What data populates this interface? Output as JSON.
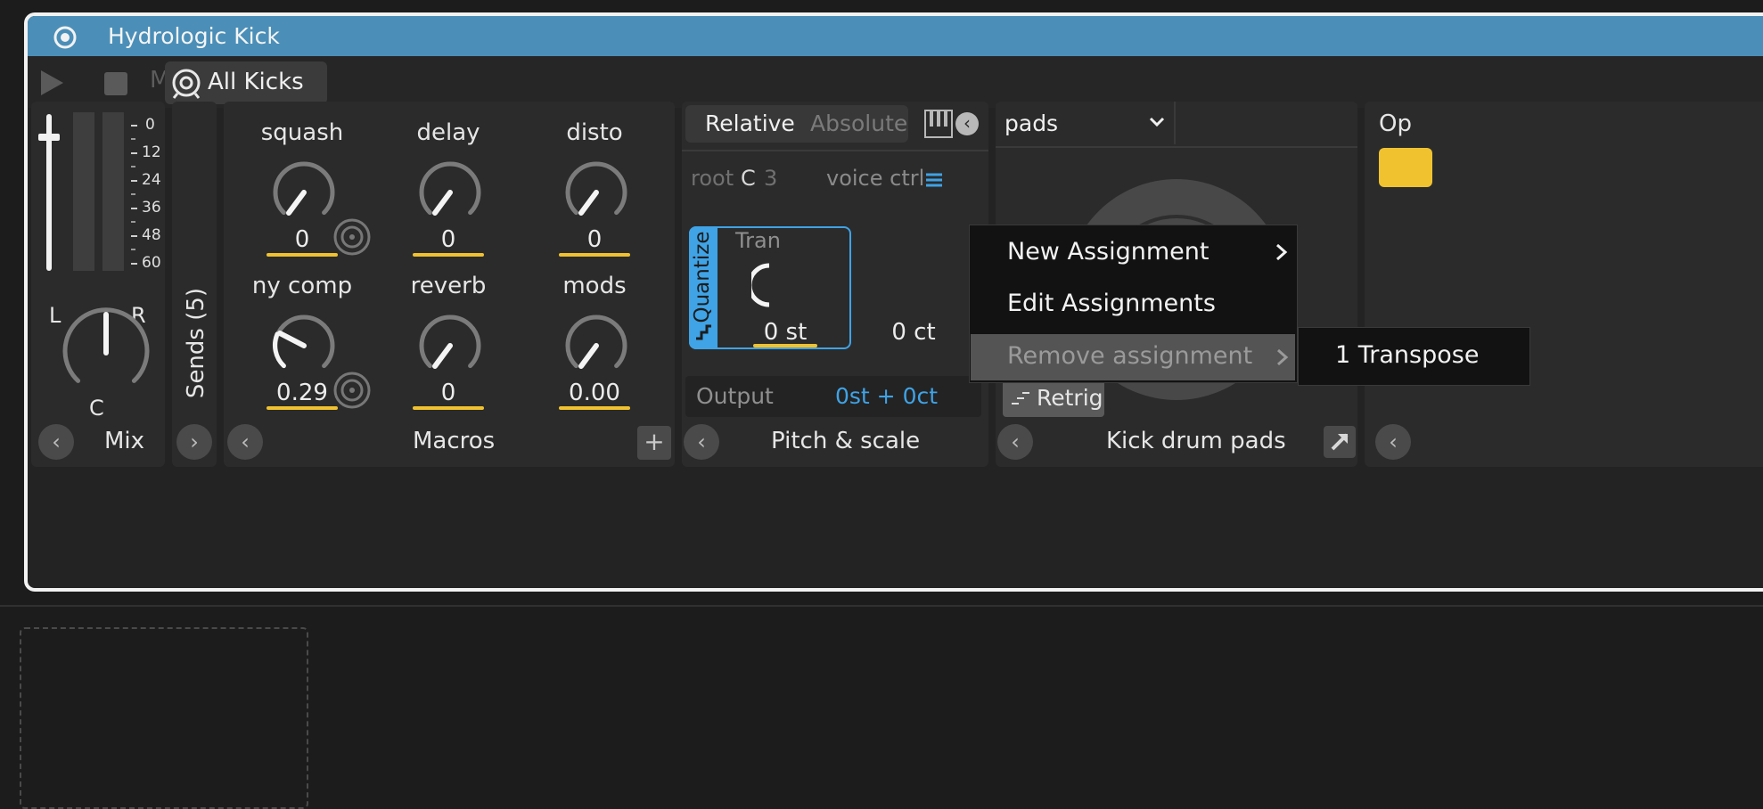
{
  "window": {
    "title": "Hydrologic Kick",
    "preset": "All Kicks",
    "mute_label": "M"
  },
  "mix": {
    "scale": [
      "0",
      "12",
      "24",
      "36",
      "48",
      "60"
    ],
    "pan_left": "L",
    "pan_right": "R",
    "pan_value": "C",
    "footer": "Mix"
  },
  "sends": {
    "label": "Sends (5)"
  },
  "macros": {
    "footer": "Macros",
    "add_label": "+",
    "knobs": [
      {
        "name": "squash",
        "value": "0"
      },
      {
        "name": "delay",
        "value": "0"
      },
      {
        "name": "disto",
        "value": "0"
      },
      {
        "name": "ny comp",
        "value": "0.29"
      },
      {
        "name": "reverb",
        "value": "0"
      },
      {
        "name": "mods",
        "value": "0.00"
      }
    ]
  },
  "pitch": {
    "tab_relative": "Relative",
    "tab_absolute": "Absolute",
    "root_label": "root",
    "root_note": "C",
    "root_octave": "3",
    "voice_ctrl": "voice ctrl",
    "quantize": "Quantize",
    "transpose_partial": "Tran",
    "st_value": "0 st",
    "ct_value": "0 ct",
    "output_label": "Output",
    "output_value": "0st + 0ct",
    "footer": "Pitch & scale"
  },
  "pads": {
    "selector": "pads",
    "retrig": "Retrig",
    "footer": "Kick drum pads"
  },
  "next_panel": {
    "title_partial": "Op"
  },
  "context_menu": {
    "items": [
      "New Assignment",
      "Edit Assignments",
      "Remove assignment"
    ],
    "submenu": [
      "1 Transpose"
    ]
  },
  "colors": {
    "titlebar": "#4b8fb8",
    "accent_blue": "#3fa3e6",
    "macro_yellow": "#f0c230"
  }
}
